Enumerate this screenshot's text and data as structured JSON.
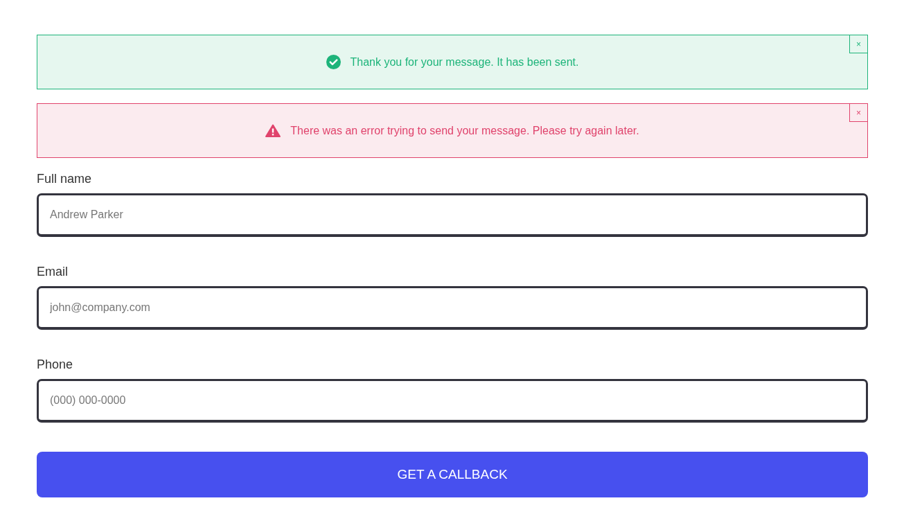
{
  "alerts": [
    {
      "kind": "success",
      "message": "Thank you for your message. It has been sent.",
      "close": "×"
    },
    {
      "kind": "error",
      "message": "There was an error trying to send your message. Please try again later.",
      "close": "×"
    }
  ],
  "fields": [
    {
      "label": "Full name",
      "placeholder": "Andrew Parker"
    },
    {
      "label": "Email",
      "placeholder": "john@company.com"
    },
    {
      "label": "Phone",
      "placeholder": "(000) 000-0000"
    }
  ],
  "submit": "GET A CALLBACK"
}
